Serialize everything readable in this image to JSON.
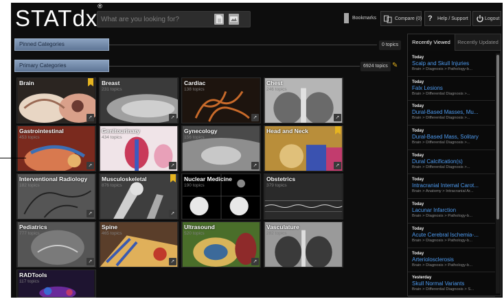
{
  "header": {
    "logo": "STATdx",
    "logo_mark": "®",
    "search_placeholder": "What are you looking for?",
    "bookmarks": "Bookmarks",
    "compare": "Compare (0)",
    "help": "Help / Support",
    "logout": "Logout"
  },
  "pinned": {
    "label": "Pinned Categories",
    "count": "0 topics"
  },
  "primary": {
    "label": "Primary Categories",
    "count": "6924 topics"
  },
  "tiles": [
    {
      "title": "Brain",
      "sub": ""
    },
    {
      "title": "Breast",
      "sub": "231 topics"
    },
    {
      "title": "Cardiac",
      "sub": "138 topics"
    },
    {
      "title": "Chest",
      "sub": "246 topics"
    },
    {
      "title": "Gastrointestinal",
      "sub": "453 topics"
    },
    {
      "title": "Genitourinary",
      "sub": "434 topics"
    },
    {
      "title": "Gynecology",
      "sub": "156 topics"
    },
    {
      "title": "Head and Neck",
      "sub": ""
    },
    {
      "title": "Interventional Radiology",
      "sub": "182 topics"
    },
    {
      "title": "Musculoskeletal",
      "sub": "876 topics"
    },
    {
      "title": "Nuclear Medicine",
      "sub": "190 topics"
    },
    {
      "title": "Obstetrics",
      "sub": "379 topics"
    },
    {
      "title": "Pediatrics",
      "sub": "777 topics"
    },
    {
      "title": "Spine",
      "sub": "465 topics"
    },
    {
      "title": "Ultrasound",
      "sub": "520 topics"
    },
    {
      "title": "Vasculature",
      "sub": "282 topics"
    },
    {
      "title": "RADTools",
      "sub": "117 topics"
    }
  ],
  "panel": {
    "tab_recent": "Recently Viewed",
    "tab_updated": "Recently Updated",
    "items": [
      {
        "when": "Today",
        "title": "Scalp and Skull Injuries",
        "path": "Brain > Diagnosis > Pathology-b..."
      },
      {
        "when": "Today",
        "title": "Falx Lesions",
        "path": "Brain > Differential Diagnosis >..."
      },
      {
        "when": "Today",
        "title": "Dural-Based Masses, Mu...",
        "path": "Brain > Differential Diagnosis >..."
      },
      {
        "when": "Today",
        "title": "Dural-Based Mass, Solitary",
        "path": "Brain > Differential Diagnosis >..."
      },
      {
        "when": "Today",
        "title": "Dural Calcification(s)",
        "path": "Brain > Differential Diagnosis >..."
      },
      {
        "when": "Today",
        "title": "Intracranial Internal Carot...",
        "path": "Brain > Anatomy > Intracranial Ar..."
      },
      {
        "when": "Today",
        "title": "Lacunar Infarction",
        "path": "Brain > Diagnosis > Pathology-b..."
      },
      {
        "when": "Today",
        "title": "Acute Cerebral Ischemia-...",
        "path": "Brain > Diagnosis > Pathology-b..."
      },
      {
        "when": "Today",
        "title": "Arteriolosclerosis",
        "path": "Brain > Diagnosis > Pathology-b..."
      },
      {
        "when": "Yesterday",
        "title": "Skull Normal Variants",
        "path": "Brain > Differential Diagnosis > S..."
      }
    ]
  },
  "colors": {
    "link": "#4e9bf0",
    "bookmark": "#e6b420",
    "bar": "#7189aa"
  }
}
